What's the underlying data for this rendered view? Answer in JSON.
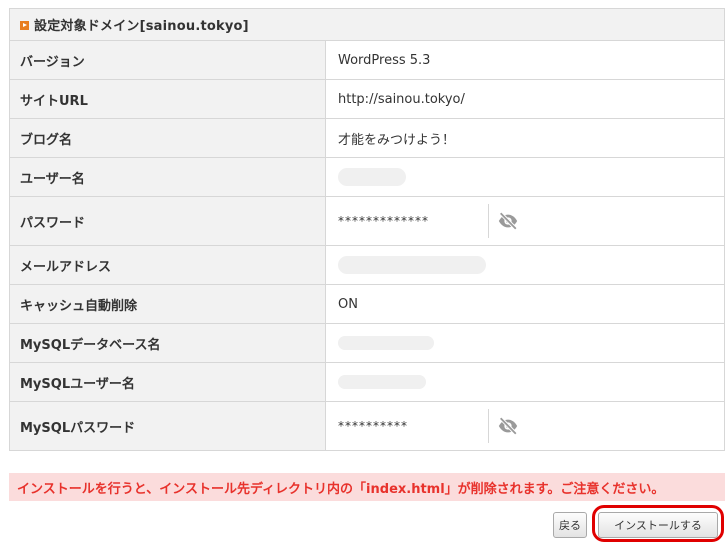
{
  "header": {
    "title": "設定対象ドメイン[sainou.tokyo]"
  },
  "rows": [
    {
      "label": "バージョン",
      "value": "WordPress 5.3"
    },
    {
      "label": "サイトURL",
      "value": "http://sainou.tokyo/"
    },
    {
      "label": "ブログ名",
      "value": "才能をみつけよう！"
    },
    {
      "label": "ユーザー名",
      "value": ""
    },
    {
      "label": "パスワード",
      "value": "*************"
    },
    {
      "label": "メールアドレス",
      "value": ""
    },
    {
      "label": "キャッシュ自動削除",
      "value": "ON"
    },
    {
      "label": "MySQLデータベース名",
      "value": ""
    },
    {
      "label": "MySQLユーザー名",
      "value": ""
    },
    {
      "label": "MySQLパスワード",
      "value": "**********"
    }
  ],
  "notice": "インストールを行うと、インストール先ディレクトリ内の「index.html」が削除されます。ご注意ください。",
  "buttons": {
    "back": "戻る",
    "install": "インストールする"
  },
  "icons": {
    "header_bullet": "orange-square-arrow-icon",
    "password_toggle": "eye-slash-icon"
  },
  "colors": {
    "accent_orange": "#e87d1e",
    "notice_text": "#e8322c",
    "notice_bg": "#fbdcdc",
    "highlight_ring": "#e00000"
  }
}
